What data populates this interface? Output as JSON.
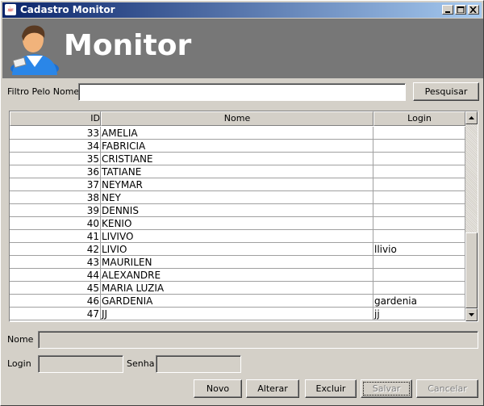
{
  "window": {
    "title": "Cadastro Monitor",
    "min_icon": "minimize-icon",
    "max_icon": "maximize-icon",
    "close_icon": "close-icon"
  },
  "banner": {
    "heading": "Monitor",
    "icon": "user-avatar-icon"
  },
  "filter": {
    "label": "Filtro Pelo Nome",
    "value": "",
    "search_button": "Pesquisar"
  },
  "table": {
    "columns": [
      "ID",
      "Nome",
      "Login"
    ],
    "rows": [
      [
        "33",
        "AMELIA",
        ""
      ],
      [
        "34",
        "FABRICIA",
        ""
      ],
      [
        "35",
        "CRISTIANE",
        ""
      ],
      [
        "36",
        "TATIANE",
        ""
      ],
      [
        "37",
        "NEYMAR",
        ""
      ],
      [
        "38",
        "NEY",
        ""
      ],
      [
        "39",
        "DENNIS",
        ""
      ],
      [
        "40",
        "KENIO",
        ""
      ],
      [
        "41",
        "LIVIVO",
        ""
      ],
      [
        "42",
        "LIVIO",
        "llivio"
      ],
      [
        "43",
        "MAURILEN",
        ""
      ],
      [
        "44",
        "ALEXANDRE",
        ""
      ],
      [
        "45",
        "MARIA LUZIA",
        ""
      ],
      [
        "46",
        "GARDENIA",
        "gardenia"
      ],
      [
        "47",
        "JJ",
        "jj"
      ]
    ]
  },
  "form": {
    "nome_label": "Nome",
    "login_label": "Login",
    "senha_label": "Senha"
  },
  "buttons": {
    "novo": "Novo",
    "alterar": "Alterar",
    "excluir": "Excluir",
    "salvar": "Salvar",
    "cancelar": "Cancelar"
  }
}
